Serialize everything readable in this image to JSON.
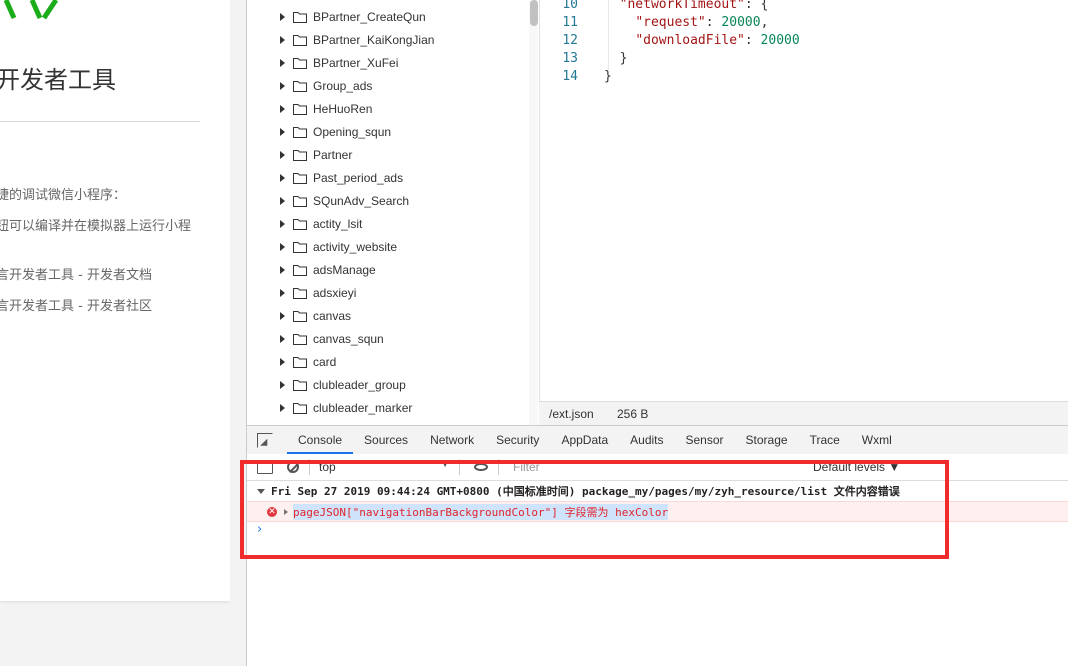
{
  "left_panel": {
    "title": "开发者工具",
    "lines": [
      "捷的调试微信小程序：",
      "钮可以编译并在模拟器上运行小程",
      "言开发者工具 - 开发者文档",
      "言开发者工具 - 开发者社区"
    ]
  },
  "file_tree": {
    "folders": [
      "BPartner_CreateQun",
      "BPartner_KaiKongJian",
      "BPartner_XuFei",
      "Group_ads",
      "HeHuoRen",
      "Opening_squn",
      "Partner",
      "Past_period_ads",
      "SQunAdv_Search",
      "actity_lsit",
      "activity_website",
      "adsManage",
      "adsxieyi",
      "canvas",
      "canvas_squn",
      "card",
      "clubleader_group",
      "clubleader_marker"
    ]
  },
  "editor": {
    "lines": [
      {
        "no": "10",
        "indent": "  ",
        "key": "\"networkTimeout\"",
        "rest": ": {"
      },
      {
        "no": "11",
        "indent": "    ",
        "key": "\"request\"",
        "sep": ": ",
        "num": "20000",
        "tail": ","
      },
      {
        "no": "12",
        "indent": "    ",
        "key": "\"downloadFile\"",
        "sep": ": ",
        "num": "20000",
        "tail": ""
      },
      {
        "no": "13",
        "indent": "  ",
        "key": "",
        "rest": "}"
      },
      {
        "no": "14",
        "indent": "",
        "key": "",
        "rest": "}"
      }
    ]
  },
  "statusbar": {
    "path": "/ext.json",
    "size": "256 B"
  },
  "tabs": [
    "Console",
    "Sources",
    "Network",
    "Security",
    "AppData",
    "Audits",
    "Sensor",
    "Storage",
    "Trace",
    "Wxml"
  ],
  "active_tab": "Console",
  "console_toolbar": {
    "context": "top",
    "context_arrow": "▼",
    "filter_placeholder": "Filter",
    "levels": "Default levels ▼"
  },
  "console": {
    "group_header": "Fri Sep 27 2019 09:44:24 GMT+0800 (中国标准时间) package_my/pages/my/zyh_resource/list 文件内容错误",
    "error_icon": "✕",
    "error_message": "pageJSON[\"navigationBarBackgroundColor\"] 字段需为 hexColor",
    "prompt": "›"
  },
  "colors": {
    "highlight_border": "#ef2b2b",
    "error_text": "#e0242a",
    "active_tab_underline": "#1a73e8",
    "logo_green": "#1aad19"
  }
}
